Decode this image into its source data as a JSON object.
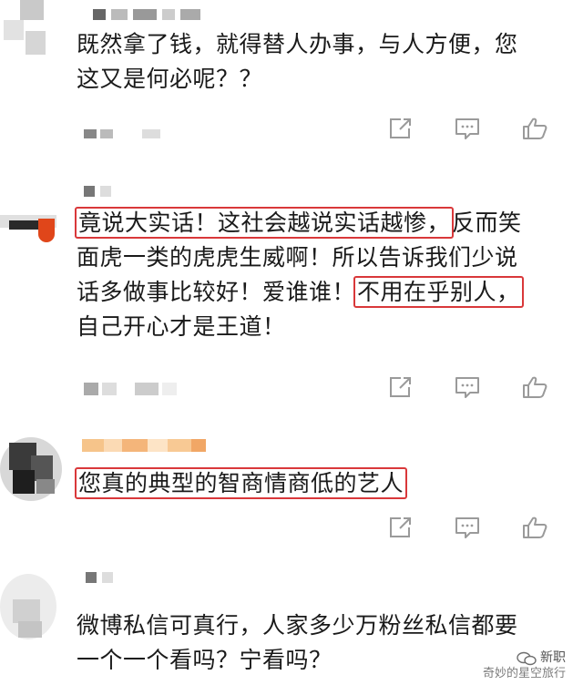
{
  "comments": [
    {
      "lines": [
        "既然拿了钱，就得替人办事，与人方便，您",
        "这又是何必呢？？"
      ]
    },
    {
      "lines": [
        {
          "pre": "",
          "hl": "竟说大实话！这社会越说实话越惨，",
          "post": "反而笑"
        },
        {
          "pre": "面虎一类的虎虎生威啊！所以告诉我们少说",
          "hl": "",
          "post": ""
        },
        {
          "pre": "话多做事比较好！爱谁谁！",
          "hl": "不用在乎别人，",
          "post": ""
        },
        {
          "pre": "自己开心才是王道！",
          "hl": "",
          "post": ""
        }
      ]
    },
    {
      "lines": [
        {
          "pre": "",
          "hl": "您真的典型的智商情商低的艺人",
          "post": ""
        }
      ]
    },
    {
      "lines": [
        "微博私信可真行，人家多少万粉丝私信都要",
        "一个一个看吗？宁看吗？"
      ]
    }
  ],
  "watermark": {
    "top": "新职",
    "bottom": "奇妙的星空旅行"
  },
  "colors": {
    "highlight_border": "#d9383a",
    "icon_stroke": "#9a9a9a",
    "text": "#1a1a1a"
  },
  "icons": [
    "share-icon",
    "comment-icon",
    "like-icon"
  ]
}
